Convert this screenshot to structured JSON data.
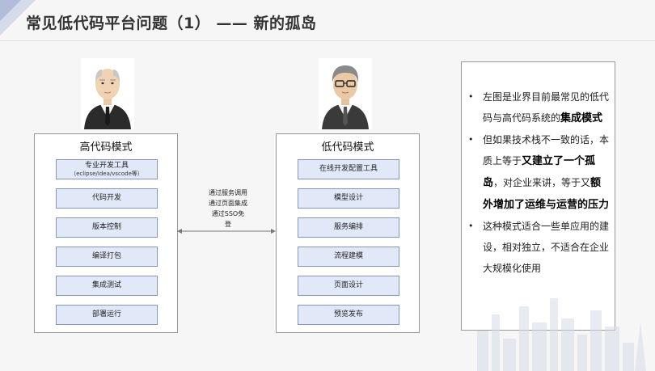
{
  "title": "常见低代码平台问题（1） —— 新的孤岛",
  "high_code": {
    "title": "高代码模式",
    "items": [
      {
        "label": "专业开发工具",
        "sub": "（eclipse/idea/vscode等）"
      },
      {
        "label": "代码开发"
      },
      {
        "label": "版本控制"
      },
      {
        "label": "编译打包"
      },
      {
        "label": "集成测试"
      },
      {
        "label": "部署运行"
      }
    ]
  },
  "low_code": {
    "title": "低代码模式",
    "items": [
      {
        "label": "在线开发配置工具"
      },
      {
        "label": "模型设计"
      },
      {
        "label": "服务编排"
      },
      {
        "label": "流程建模"
      },
      {
        "label": "页面设计"
      },
      {
        "label": "预览发布"
      }
    ]
  },
  "connector": {
    "lines": [
      "通过服务调用",
      "通过页面集成",
      "通过SSO免",
      "登"
    ]
  },
  "notes": [
    [
      {
        "t": "左图是业界目前最常见的低代码与高代码系统的",
        "b": false
      },
      {
        "t": "集成模式",
        "b": true
      }
    ],
    [
      {
        "t": "但如果技术栈不一致的话，本质上等于",
        "b": false
      },
      {
        "t": "又建立了一个孤岛",
        "b": true
      },
      {
        "t": "，对企业来讲，等于又",
        "b": false
      },
      {
        "t": "额外增加了运维与运营的压力",
        "b": true
      }
    ],
    [
      {
        "t": "这种模式适合一些单应用的建设，相对独立，不适合在企业大规模化使用",
        "b": false
      }
    ]
  ],
  "colors": {
    "item_fill": "#e1e9f8",
    "item_border": "#8597bb",
    "accent": "#aab4d4"
  }
}
